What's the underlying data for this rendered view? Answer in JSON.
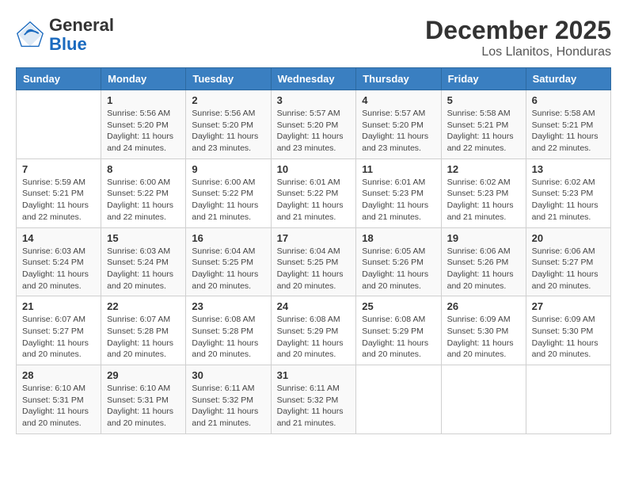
{
  "header": {
    "logo_general": "General",
    "logo_blue": "Blue",
    "title": "December 2025",
    "subtitle": "Los Llanitos, Honduras"
  },
  "days_of_week": [
    "Sunday",
    "Monday",
    "Tuesday",
    "Wednesday",
    "Thursday",
    "Friday",
    "Saturday"
  ],
  "weeks": [
    [
      {
        "day": "",
        "info": ""
      },
      {
        "day": "1",
        "info": "Sunrise: 5:56 AM\nSunset: 5:20 PM\nDaylight: 11 hours and 24 minutes."
      },
      {
        "day": "2",
        "info": "Sunrise: 5:56 AM\nSunset: 5:20 PM\nDaylight: 11 hours and 23 minutes."
      },
      {
        "day": "3",
        "info": "Sunrise: 5:57 AM\nSunset: 5:20 PM\nDaylight: 11 hours and 23 minutes."
      },
      {
        "day": "4",
        "info": "Sunrise: 5:57 AM\nSunset: 5:20 PM\nDaylight: 11 hours and 23 minutes."
      },
      {
        "day": "5",
        "info": "Sunrise: 5:58 AM\nSunset: 5:21 PM\nDaylight: 11 hours and 22 minutes."
      },
      {
        "day": "6",
        "info": "Sunrise: 5:58 AM\nSunset: 5:21 PM\nDaylight: 11 hours and 22 minutes."
      }
    ],
    [
      {
        "day": "7",
        "info": "Sunrise: 5:59 AM\nSunset: 5:21 PM\nDaylight: 11 hours and 22 minutes."
      },
      {
        "day": "8",
        "info": "Sunrise: 6:00 AM\nSunset: 5:22 PM\nDaylight: 11 hours and 22 minutes."
      },
      {
        "day": "9",
        "info": "Sunrise: 6:00 AM\nSunset: 5:22 PM\nDaylight: 11 hours and 21 minutes."
      },
      {
        "day": "10",
        "info": "Sunrise: 6:01 AM\nSunset: 5:22 PM\nDaylight: 11 hours and 21 minutes."
      },
      {
        "day": "11",
        "info": "Sunrise: 6:01 AM\nSunset: 5:23 PM\nDaylight: 11 hours and 21 minutes."
      },
      {
        "day": "12",
        "info": "Sunrise: 6:02 AM\nSunset: 5:23 PM\nDaylight: 11 hours and 21 minutes."
      },
      {
        "day": "13",
        "info": "Sunrise: 6:02 AM\nSunset: 5:23 PM\nDaylight: 11 hours and 21 minutes."
      }
    ],
    [
      {
        "day": "14",
        "info": "Sunrise: 6:03 AM\nSunset: 5:24 PM\nDaylight: 11 hours and 20 minutes."
      },
      {
        "day": "15",
        "info": "Sunrise: 6:03 AM\nSunset: 5:24 PM\nDaylight: 11 hours and 20 minutes."
      },
      {
        "day": "16",
        "info": "Sunrise: 6:04 AM\nSunset: 5:25 PM\nDaylight: 11 hours and 20 minutes."
      },
      {
        "day": "17",
        "info": "Sunrise: 6:04 AM\nSunset: 5:25 PM\nDaylight: 11 hours and 20 minutes."
      },
      {
        "day": "18",
        "info": "Sunrise: 6:05 AM\nSunset: 5:26 PM\nDaylight: 11 hours and 20 minutes."
      },
      {
        "day": "19",
        "info": "Sunrise: 6:06 AM\nSunset: 5:26 PM\nDaylight: 11 hours and 20 minutes."
      },
      {
        "day": "20",
        "info": "Sunrise: 6:06 AM\nSunset: 5:27 PM\nDaylight: 11 hours and 20 minutes."
      }
    ],
    [
      {
        "day": "21",
        "info": "Sunrise: 6:07 AM\nSunset: 5:27 PM\nDaylight: 11 hours and 20 minutes."
      },
      {
        "day": "22",
        "info": "Sunrise: 6:07 AM\nSunset: 5:28 PM\nDaylight: 11 hours and 20 minutes."
      },
      {
        "day": "23",
        "info": "Sunrise: 6:08 AM\nSunset: 5:28 PM\nDaylight: 11 hours and 20 minutes."
      },
      {
        "day": "24",
        "info": "Sunrise: 6:08 AM\nSunset: 5:29 PM\nDaylight: 11 hours and 20 minutes."
      },
      {
        "day": "25",
        "info": "Sunrise: 6:08 AM\nSunset: 5:29 PM\nDaylight: 11 hours and 20 minutes."
      },
      {
        "day": "26",
        "info": "Sunrise: 6:09 AM\nSunset: 5:30 PM\nDaylight: 11 hours and 20 minutes."
      },
      {
        "day": "27",
        "info": "Sunrise: 6:09 AM\nSunset: 5:30 PM\nDaylight: 11 hours and 20 minutes."
      }
    ],
    [
      {
        "day": "28",
        "info": "Sunrise: 6:10 AM\nSunset: 5:31 PM\nDaylight: 11 hours and 20 minutes."
      },
      {
        "day": "29",
        "info": "Sunrise: 6:10 AM\nSunset: 5:31 PM\nDaylight: 11 hours and 20 minutes."
      },
      {
        "day": "30",
        "info": "Sunrise: 6:11 AM\nSunset: 5:32 PM\nDaylight: 11 hours and 21 minutes."
      },
      {
        "day": "31",
        "info": "Sunrise: 6:11 AM\nSunset: 5:32 PM\nDaylight: 11 hours and 21 minutes."
      },
      {
        "day": "",
        "info": ""
      },
      {
        "day": "",
        "info": ""
      },
      {
        "day": "",
        "info": ""
      }
    ]
  ]
}
